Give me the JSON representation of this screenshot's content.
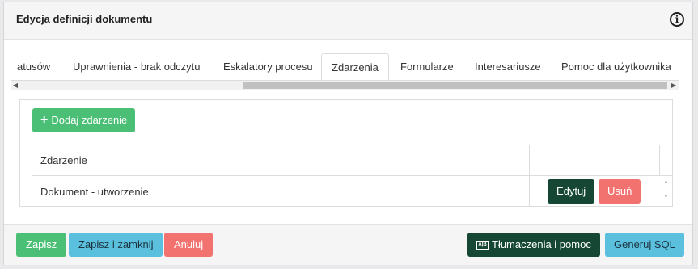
{
  "dialog": {
    "title": "Edycja definicji dokumentu",
    "info_icon": "i"
  },
  "tabs": [
    {
      "label": "atusów",
      "active": false
    },
    {
      "label": "Uprawnienia - brak odczytu",
      "active": false
    },
    {
      "label": "Eskalatory procesu",
      "active": false
    },
    {
      "label": "Zdarzenia",
      "active": true
    },
    {
      "label": "Formularze",
      "active": false
    },
    {
      "label": "Interesariusze",
      "active": false
    },
    {
      "label": "Pomoc dla użytkownika",
      "active": false
    }
  ],
  "events": {
    "add_button_label": "Dodaj zdarzenie",
    "add_icon": "+",
    "column_header": "Zdarzenie",
    "rows": [
      {
        "name": "Dokument - utworzenie",
        "edit_label": "Edytuj",
        "delete_label": "Usuń"
      }
    ]
  },
  "footer": {
    "save_label": "Zapisz",
    "save_close_label": "Zapisz i zamknij",
    "cancel_label": "Anuluj",
    "translations_icon": "A|B",
    "translations_label": "Tłumaczenia i pomoc",
    "sql_label": "Generuj SQL"
  },
  "colors": {
    "success": "#4cbf76",
    "info": "#5bc0de",
    "danger": "#f2726f",
    "dark": "#154734"
  }
}
